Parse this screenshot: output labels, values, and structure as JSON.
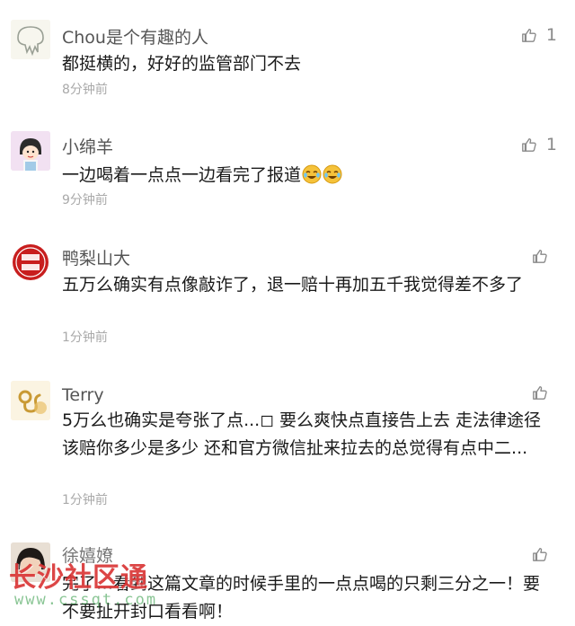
{
  "comments": [
    {
      "nickname": "Chou是个有趣的人",
      "text": "都挺横的，好好的监管部门不去",
      "time": "8分钟前",
      "likes": "1",
      "avatar_icon": "cartoon-drip-avatar-icon"
    },
    {
      "nickname": "小绵羊",
      "text": "一边喝着一点点一边看完了报道",
      "time": "9分钟前",
      "likes": "1",
      "avatar_icon": "girl-cartoon-avatar-icon",
      "emojis": [
        "laugh-cry-emoji-icon",
        "laugh-cry-emoji-icon"
      ]
    },
    {
      "nickname": "鸭梨山大",
      "text": "五万么确实有点像敲诈了，退一赔十再加五千我觉得差不多了",
      "time": "1分钟前",
      "likes": "",
      "avatar_icon": "red-badge-avatar-icon"
    },
    {
      "nickname": "Terry",
      "text": "5万么也确实是夸张了点...◻ 要么爽快点直接告上去 走法律途径该赔你多少是多少 还和官方微信扯来拉去的总觉得有点中二...",
      "time": "1分钟前",
      "likes": "",
      "avatar_icon": "leo-zodiac-avatar-icon"
    },
    {
      "nickname": "徐嬉嫽",
      "text": "完了…看到这篇文章的时候手里的一点点喝的只剩三分之一！要不要扯开封口看看啊！",
      "time": "",
      "likes": "",
      "avatar_icon": "dark-hair-avatar-icon"
    }
  ],
  "watermark": {
    "title": "长沙社区通",
    "url": "www.cssqt.com"
  },
  "colors": {
    "like_icon": "#8a8a8a",
    "time": "#a9a9a9",
    "watermark_red": "#d62626"
  }
}
